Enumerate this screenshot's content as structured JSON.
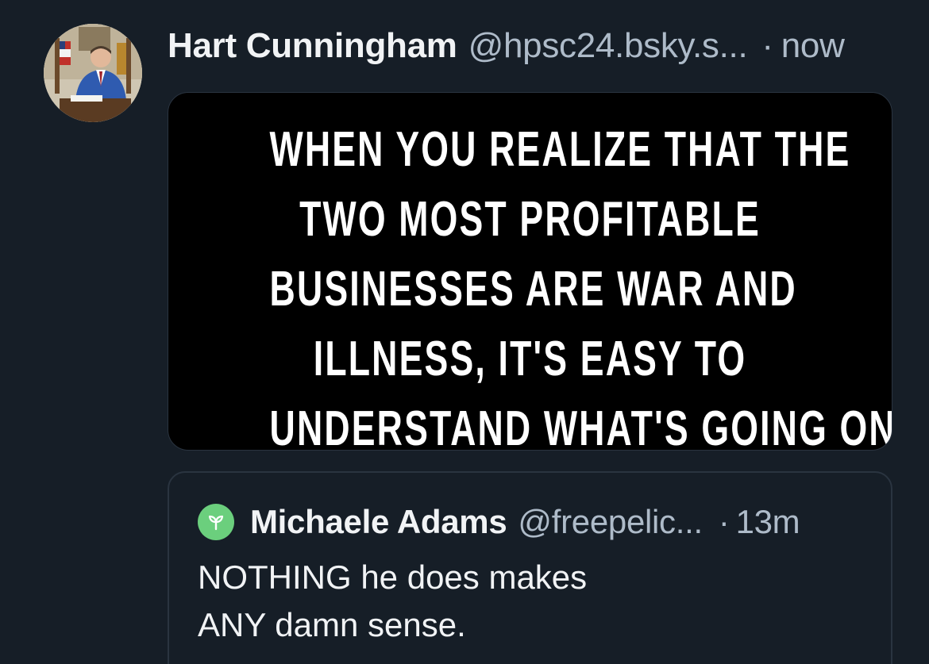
{
  "post": {
    "author_name": "Hart Cunningham",
    "author_handle": "@hpsc24.bsky.s...",
    "separator": "·",
    "timestamp": "now",
    "image_text_lines": [
      "WHEN YOU REALIZE THAT THE",
      "TWO MOST PROFITABLE",
      "BUSINESSES ARE WAR AND",
      "ILLNESS, IT'S EASY TO",
      "UNDERSTAND WHAT'S GOING ON"
    ]
  },
  "quote": {
    "author_name": "Michaele Adams",
    "author_handle": "@freepelic...",
    "separator": "·",
    "timestamp": "13m",
    "text_lines": [
      "NOTHING he does makes",
      "ANY damn sense."
    ]
  },
  "colors": {
    "background": "#161e27",
    "primary_text": "#f1f3f5",
    "secondary_text": "#aebbc9",
    "quote_avatar": "#6bcf7d",
    "border": "#2a3440"
  },
  "icons": {
    "post_avatar": "profile-photo",
    "quote_avatar": "sprout-icon"
  }
}
